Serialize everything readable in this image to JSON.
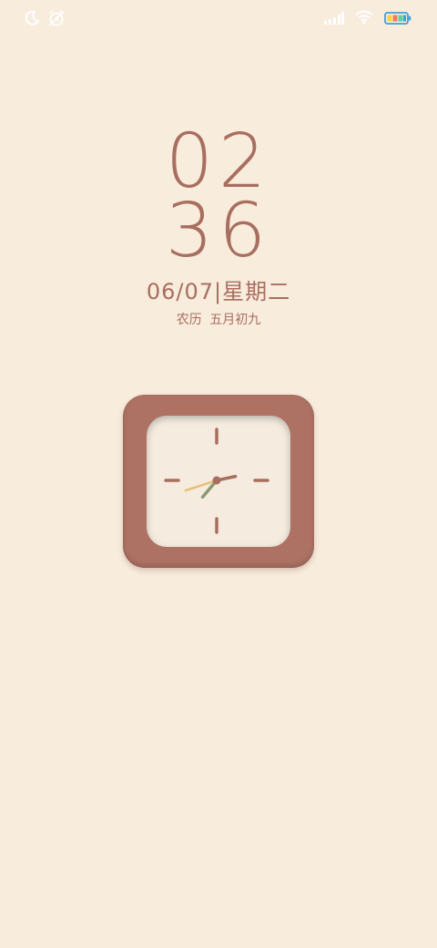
{
  "status_bar": {
    "left_icons": [
      "moon-icon",
      "alarm-off-icon"
    ],
    "right_icons": [
      "signal-icon",
      "wifi-icon",
      "battery-icon"
    ],
    "battery_color": "#3aa0e0"
  },
  "lock_screen": {
    "hour": "02",
    "minute": "36",
    "date": "06/07",
    "separator": "|",
    "weekday": "星期二",
    "lunar_label": "农历",
    "lunar_date": "五月初九"
  },
  "clock_widget": {
    "hour": 2,
    "minute": 36,
    "second": 42,
    "frame_color": "#ad7264",
    "face_color": "#f5ecdf",
    "hour_hand_color": "#a86e5f",
    "minute_hand_color": "#8a9a72",
    "second_hand_color": "#e8c07a"
  }
}
